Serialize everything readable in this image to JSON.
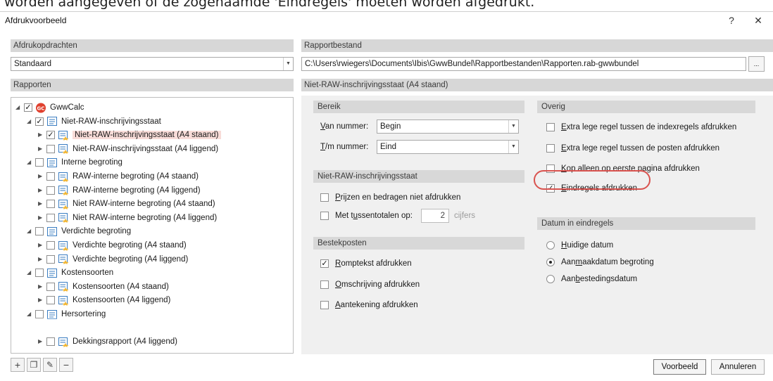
{
  "caption": "worden aangegeven of de zogenaamde 'Eindregels' moeten worden afgedrukt.",
  "window": {
    "title": "Afdrukvoorbeeld",
    "help": "?",
    "close": "✕"
  },
  "left": {
    "afdrukopdrachten_header": "Afdrukopdrachten",
    "afdrukopdracht_value": "Standaard",
    "rapporten_header": "Rapporten"
  },
  "tree": [
    {
      "label": "GwwCalc",
      "checked": true,
      "level": 0,
      "type": "root"
    },
    {
      "label": "Niet-RAW-inschrijvingsstaat",
      "checked": true,
      "level": 1,
      "type": "group"
    },
    {
      "label": "Niet-RAW-inschrijvingsstaat (A4 staand)",
      "checked": true,
      "level": 2,
      "type": "report",
      "selected": true
    },
    {
      "label": "Niet-RAW-inschrijvingsstaat (A4 liggend)",
      "checked": false,
      "level": 2,
      "type": "report"
    },
    {
      "label": "Interne begroting",
      "checked": false,
      "level": 1,
      "type": "group"
    },
    {
      "label": "RAW-interne begroting (A4 staand)",
      "checked": false,
      "level": 2,
      "type": "report"
    },
    {
      "label": "RAW-interne begroting (A4 liggend)",
      "checked": false,
      "level": 2,
      "type": "report"
    },
    {
      "label": "Niet RAW-interne begroting (A4 staand)",
      "checked": false,
      "level": 2,
      "type": "report"
    },
    {
      "label": "Niet RAW-interne begroting (A4 liggend)",
      "checked": false,
      "level": 2,
      "type": "report"
    },
    {
      "label": "Verdichte begroting",
      "checked": false,
      "level": 1,
      "type": "group"
    },
    {
      "label": "Verdichte begroting (A4 staand)",
      "checked": false,
      "level": 2,
      "type": "report"
    },
    {
      "label": "Verdichte begroting (A4 liggend)",
      "checked": false,
      "level": 2,
      "type": "report"
    },
    {
      "label": "Kostensoorten",
      "checked": false,
      "level": 1,
      "type": "group"
    },
    {
      "label": "Kostensoorten (A4 staand)",
      "checked": false,
      "level": 2,
      "type": "report"
    },
    {
      "label": "Kostensoorten (A4 liggend)",
      "checked": false,
      "level": 2,
      "type": "report"
    },
    {
      "label": "Hersortering",
      "checked": false,
      "level": 1,
      "type": "group"
    },
    {
      "label": "",
      "checked": false,
      "level": 1,
      "type": "hidden"
    },
    {
      "label": "Dekkingsrapport (A4 liggend)",
      "checked": false,
      "level": 2,
      "type": "report"
    }
  ],
  "right": {
    "rapportbestand_header": "Rapportbestand",
    "rapportbestand_path": "C:\\Users\\rwiegers\\Documents\\Ibis\\GwwBundel\\Rapportbestanden\\Rapporten.rab-gwwbundel",
    "browse": "...",
    "report_header": "Niet-RAW-inschrijvingsstaat (A4 staand)"
  },
  "bereik": {
    "header": "Bereik",
    "van_label_u": "V",
    "van_label_rest": "an nummer:",
    "van_value": "Begin",
    "tm_label_u": "T",
    "tm_label_rest": "/m nummer:",
    "tm_value": "Eind"
  },
  "nrs": {
    "header": "Niet-RAW-inschrijvingsstaat",
    "prijzen_u": "P",
    "prijzen_rest": "rijzen en bedragen niet afdrukken",
    "tussen_pre": "Met t",
    "tussen_u": "u",
    "tussen_rest": "ssentotalen op:",
    "tussen_value": "2",
    "tussen_unit": "cijfers"
  },
  "bestek": {
    "header": "Bestekposten",
    "romp_u": "R",
    "romp_rest": "omptekst afdrukken",
    "omschr_u": "O",
    "omschr_rest": "mschrijving afdrukken",
    "aant_u": "A",
    "aant_rest": "antekening afdrukken"
  },
  "overig": {
    "header": "Overig",
    "extra1_u": "E",
    "extra1_rest": "xtra lege regel tussen de indexregels afdrukken",
    "extra2_u": "E",
    "extra2_rest": "xtra lege regel tussen de posten afdrukken",
    "kop_u": "K",
    "kop_rest": "op alleen op eerste pagina afdrukken",
    "eind_u": "E",
    "eind_rest": "indregels afdrukken"
  },
  "datum": {
    "header": "Datum in eindregels",
    "huidig_u": "H",
    "huidig_rest": "uidige datum",
    "aanmaak_pre": "Aan",
    "aanmaak_u": "m",
    "aanmaak_rest": "aakdatum begroting",
    "aanbest_pre": "Aan",
    "aanbest_u": "b",
    "aanbest_rest": "estedingsdatum"
  },
  "buttons": {
    "voorbeeld": "Voorbeeld",
    "annuleren": "Annuleren"
  },
  "colors": {
    "header_bg": "#d7d7d7",
    "panel_bg": "#f0f0f0",
    "highlight": "#d9534f",
    "selected_bg": "#f8dcd8"
  }
}
